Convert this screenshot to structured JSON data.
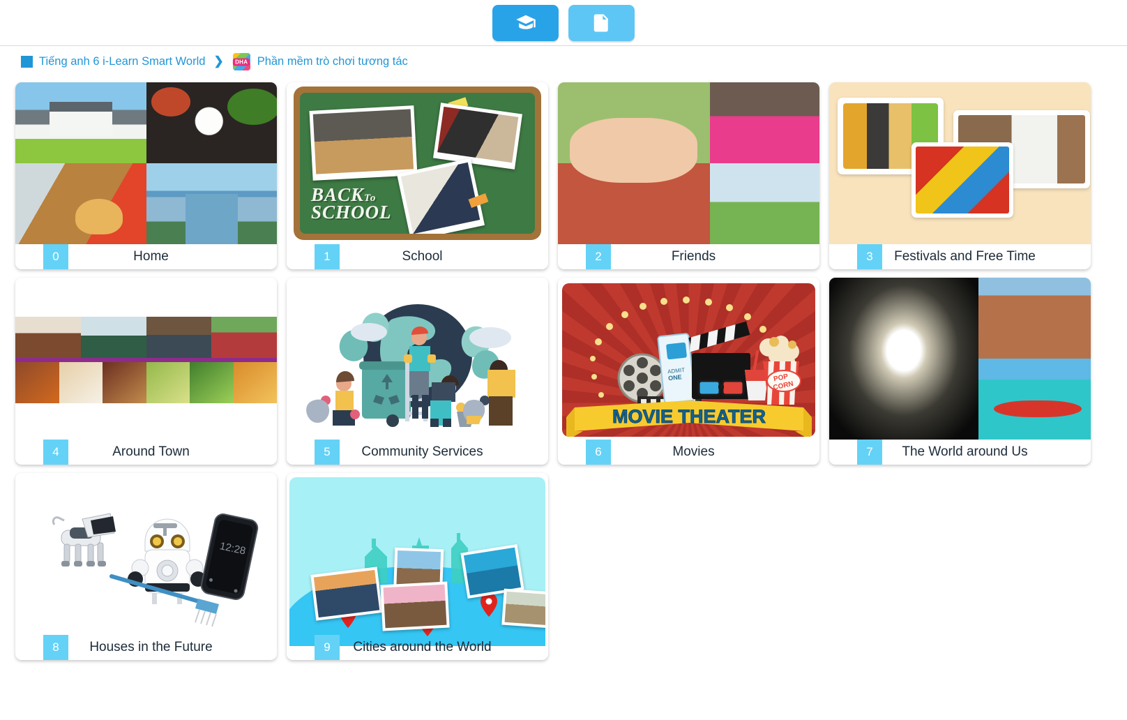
{
  "toolbar": {
    "buttons": [
      {
        "name": "graduation-cap",
        "label": "Học liệu",
        "icon": "graduation-cap-icon",
        "color": "#29a3e8",
        "active": true
      },
      {
        "name": "report",
        "label": "Báo cáo",
        "icon": "report-document-icon",
        "color": "#5dc6f5",
        "active": false
      }
    ]
  },
  "breadcrumb": {
    "marker": "",
    "items": [
      {
        "label": "Tiếng anh 6 i-Learn Smart World",
        "has_icon": false
      },
      {
        "label": "Phần mềm trò chơi tương tác",
        "has_icon": true,
        "icon_text": "DHA"
      }
    ],
    "separator": "❯",
    "link_color": "#2196d6"
  },
  "units": [
    {
      "number": "0",
      "title": "Home"
    },
    {
      "number": "1",
      "title": "School"
    },
    {
      "number": "2",
      "title": "Friends"
    },
    {
      "number": "3",
      "title": "Festivals and Free Time"
    },
    {
      "number": "4",
      "title": "Around Town"
    },
    {
      "number": "5",
      "title": "Community Services"
    },
    {
      "number": "6",
      "title": "Movies"
    },
    {
      "number": "7",
      "title": "The World around Us"
    },
    {
      "number": "8",
      "title": "Houses in the Future"
    },
    {
      "number": "9",
      "title": "Cities around the World"
    }
  ],
  "artwork": {
    "school_heading_line1": "BACK",
    "school_heading_to": "To",
    "school_heading_line2": "SCHOOL",
    "movie_banner": "MOVIE THEATER",
    "movie_popcorn_label": "POP CORN",
    "movie_ticket_label": "ADMIT ONE",
    "phone_clock": "12:28"
  },
  "colors": {
    "badge": "#64d2f6",
    "toolbar_primary": "#29a3e8",
    "toolbar_secondary": "#5dc6f5",
    "breadcrumb_link": "#2196d6",
    "title_text": "#1c2b39",
    "card_bg": "#ffffff",
    "page_bg": "#ffffff"
  }
}
